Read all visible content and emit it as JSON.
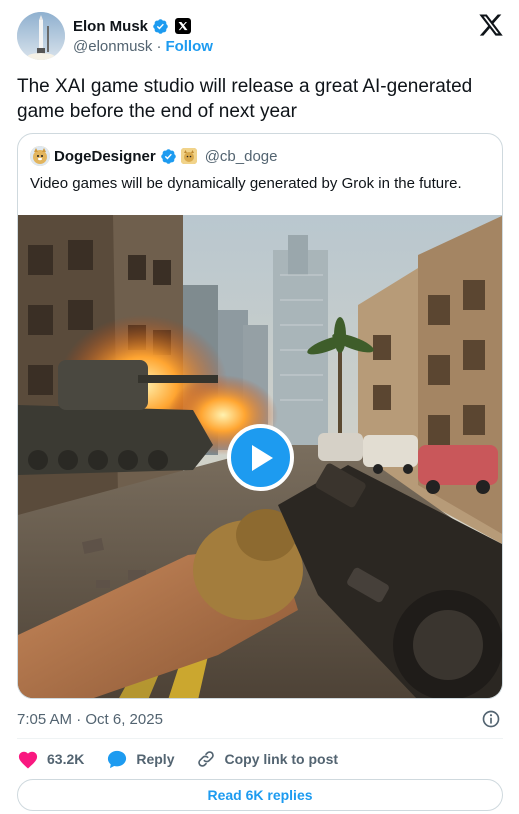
{
  "author": {
    "name": "Elon Musk",
    "handle": "@elonmusk",
    "separator": "·",
    "follow_label": "Follow"
  },
  "tweet": {
    "text": "The XAI game studio will release a great AI-generated game before the end of next year",
    "timestamp": "7:05 AM · Oct 6, 2025"
  },
  "quote": {
    "name": "DogeDesigner",
    "handle": "@cb_doge",
    "text": "Video games will be dynamically generated by Grok in the future."
  },
  "actions": {
    "likes": "63.2K",
    "reply_label": "Reply",
    "copy_label": "Copy link to post"
  },
  "read_replies_label": "Read 6K replies",
  "colors": {
    "accent": "#1d9bf0",
    "like": "#f91880",
    "text": "#0f1419",
    "secondary": "#536471",
    "border": "#cfd9de"
  },
  "icons": [
    "verified-badge-icon",
    "x-affiliate-icon",
    "x-logo-icon",
    "doge-emoji-icon",
    "play-icon",
    "info-icon",
    "heart-icon",
    "reply-bubble-icon",
    "link-icon"
  ]
}
